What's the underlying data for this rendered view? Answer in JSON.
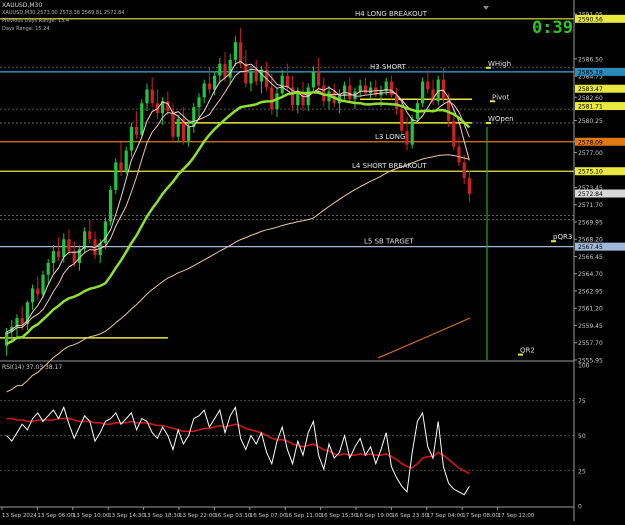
{
  "header": {
    "symbol": "XAUUSD,M30",
    "line1": "XAUUSD,M30  2573.00 2573.38 2569.81 2572.84",
    "line2": "Previous Days Range: 13.4",
    "line3": "Days Range: 15.24",
    "timer": "0:39"
  },
  "colors": {
    "bull": "#20c840",
    "bear": "#d02020",
    "level_yellow": "#e8e840",
    "level_orange": "#e07818",
    "level_blue": "#a0b8d8",
    "level_green": "#28a828",
    "ma_fast": "#e8d8c8",
    "ma_green": "#90e030",
    "ma_slow": "#e8c8a0",
    "ma_orange": "#d87020",
    "rsi": "#ffffff",
    "rsi_signal": "#d01818",
    "axis_text": "#c8c8c8"
  },
  "price_axis": {
    "ticks": [
      "2591.05",
      "2586.50",
      "2584.75",
      "2582.60",
      "2580.25",
      "2578.10",
      "2577.00",
      "2575.25",
      "2573.45",
      "2571.70",
      "2569.95",
      "2568.20",
      "2566.45",
      "2564.70",
      "2562.95",
      "2561.20",
      "2559.45",
      "2557.70",
      "2555.95"
    ],
    "max": 2591.05,
    "min": 2555.95
  },
  "price_tags": [
    {
      "value": 2590.56,
      "label": "2590.56",
      "color": "#e8e840"
    },
    {
      "value": 2585.18,
      "label": "2585.18",
      "color": "#2e8ab8"
    },
    {
      "value": 2583.47,
      "label": "2583.47",
      "color": "#e8e840"
    },
    {
      "value": 2581.71,
      "label": "2581.71",
      "color": "#e8e840"
    },
    {
      "value": 2578.09,
      "label": "2578.09",
      "color": "#e07818"
    },
    {
      "value": 2575.1,
      "label": "2575.10",
      "color": "#e8e840"
    },
    {
      "value": 2572.84,
      "label": "2572.84",
      "color": "#d8d8d8"
    },
    {
      "value": 2567.45,
      "label": "2567.45",
      "color": "#a0b8d8"
    }
  ],
  "levels": [
    {
      "name": "H4 LONG BREAKOUT",
      "value": 2590.56,
      "color": "#e8e840",
      "label_x": 355
    },
    {
      "name": "H3 SHORT",
      "value": 2585.18,
      "color": "#40a8d8",
      "label_x": 370
    },
    {
      "name": "L3 LONG",
      "value": 2578.09,
      "color": "#e07818",
      "label_x": 375
    },
    {
      "name": "L4 SHORT BREAKOUT",
      "value": 2575.1,
      "color": "#e8e840",
      "label_x": 352
    },
    {
      "name": "L5 SB TARGET",
      "value": 2567.45,
      "color": "#a0b8d8",
      "label_x": 364
    }
  ],
  "markers": [
    {
      "name": "WHigh",
      "x": 488,
      "value": 2585.8
    },
    {
      "name": "Pivot",
      "x": 492,
      "value": 2582.4
    },
    {
      "name": "WOpen",
      "x": 488,
      "value": 2580.2
    },
    {
      "name": "pQR3",
      "x": 553,
      "value": 2568.2
    },
    {
      "name": "QR2",
      "x": 520,
      "value": 2556.7
    }
  ],
  "time_axis": [
    "13 Sep 2024",
    "13 Sep 06:00",
    "13 Sep 10:00",
    "13 Sep 14:30",
    "13 Sep 18:30",
    "13 Sep 22:00",
    "16 Sep 03:30",
    "16 Sep 07:00",
    "16 Sep 11:00",
    "16 Sep 15:30",
    "16 Sep 19:00",
    "16 Sep 23:30",
    "17 Sep 04:00",
    "17 Sep 08:00",
    "17 Sep 12:00"
  ],
  "indicator": {
    "title": "RSI(14) 37.03 38.17",
    "ticks": [
      "100",
      "75",
      "50",
      "25",
      "0"
    ]
  },
  "chart_data": {
    "type": "line",
    "title": "XAUUSD,M30",
    "candles": [
      [
        2557.4,
        2559.2,
        2556.4,
        2558.8
      ],
      [
        2558.8,
        2560.0,
        2557.9,
        2559.3
      ],
      [
        2559.3,
        2560.6,
        2558.2,
        2560.2
      ],
      [
        2560.2,
        2561.4,
        2559.0,
        2559.6
      ],
      [
        2559.6,
        2562.0,
        2559.0,
        2561.8
      ],
      [
        2561.8,
        2563.6,
        2561.0,
        2563.2
      ],
      [
        2563.2,
        2564.4,
        2562.0,
        2562.6
      ],
      [
        2562.6,
        2565.0,
        2562.2,
        2564.6
      ],
      [
        2564.6,
        2566.2,
        2563.6,
        2565.8
      ],
      [
        2565.8,
        2567.6,
        2564.8,
        2567.0
      ],
      [
        2567.0,
        2568.4,
        2566.0,
        2566.4
      ],
      [
        2566.4,
        2568.8,
        2565.8,
        2568.2
      ],
      [
        2568.2,
        2569.2,
        2566.6,
        2567.0
      ],
      [
        2567.0,
        2568.0,
        2565.4,
        2565.8
      ],
      [
        2565.8,
        2567.6,
        2565.0,
        2567.2
      ],
      [
        2567.2,
        2569.4,
        2566.8,
        2569.0
      ],
      [
        2569.0,
        2570.2,
        2567.8,
        2568.2
      ],
      [
        2568.2,
        2569.0,
        2566.2,
        2566.6
      ],
      [
        2566.6,
        2568.2,
        2565.8,
        2567.8
      ],
      [
        2567.8,
        2570.4,
        2567.2,
        2570.0
      ],
      [
        2570.0,
        2573.6,
        2569.6,
        2573.2
      ],
      [
        2573.2,
        2576.4,
        2572.8,
        2576.0
      ],
      [
        2576.0,
        2578.0,
        2574.6,
        2575.2
      ],
      [
        2575.2,
        2577.6,
        2574.8,
        2577.2
      ],
      [
        2577.2,
        2580.0,
        2576.6,
        2579.6
      ],
      [
        2579.6,
        2581.2,
        2578.4,
        2578.8
      ],
      [
        2578.8,
        2582.4,
        2578.4,
        2582.0
      ],
      [
        2582.0,
        2584.0,
        2581.2,
        2583.4
      ],
      [
        2583.4,
        2584.6,
        2581.6,
        2582.0
      ],
      [
        2582.0,
        2583.4,
        2580.4,
        2581.0
      ],
      [
        2581.0,
        2582.6,
        2579.8,
        2582.2
      ],
      [
        2582.2,
        2583.2,
        2580.8,
        2581.2
      ],
      [
        2581.2,
        2582.0,
        2578.2,
        2578.6
      ],
      [
        2578.6,
        2580.8,
        2578.0,
        2580.4
      ],
      [
        2580.4,
        2581.6,
        2577.8,
        2578.2
      ],
      [
        2578.2,
        2580.2,
        2577.6,
        2579.6
      ],
      [
        2579.6,
        2582.0,
        2579.0,
        2581.6
      ],
      [
        2581.6,
        2583.0,
        2580.6,
        2582.6
      ],
      [
        2582.6,
        2584.4,
        2582.0,
        2584.0
      ],
      [
        2584.0,
        2585.6,
        2583.0,
        2583.4
      ],
      [
        2583.4,
        2585.2,
        2582.8,
        2584.8
      ],
      [
        2584.8,
        2586.6,
        2584.0,
        2586.0
      ],
      [
        2586.0,
        2587.2,
        2584.2,
        2584.6
      ],
      [
        2584.6,
        2587.0,
        2584.0,
        2586.4
      ],
      [
        2586.4,
        2588.8,
        2585.8,
        2588.2
      ],
      [
        2588.2,
        2589.6,
        2585.6,
        2586.0
      ],
      [
        2586.0,
        2587.4,
        2583.6,
        2584.0
      ],
      [
        2584.0,
        2585.8,
        2583.2,
        2585.2
      ],
      [
        2585.2,
        2586.4,
        2583.8,
        2584.2
      ],
      [
        2584.2,
        2585.8,
        2583.0,
        2585.4
      ],
      [
        2585.4,
        2586.2,
        2583.2,
        2583.6
      ],
      [
        2583.6,
        2585.0,
        2580.8,
        2581.4
      ],
      [
        2581.4,
        2583.6,
        2580.6,
        2583.0
      ],
      [
        2583.0,
        2585.4,
        2582.6,
        2584.8
      ],
      [
        2584.8,
        2586.0,
        2583.2,
        2583.6
      ],
      [
        2583.6,
        2584.8,
        2581.2,
        2581.8
      ],
      [
        2581.8,
        2583.6,
        2581.0,
        2583.0
      ],
      [
        2583.0,
        2584.2,
        2581.2,
        2581.8
      ],
      [
        2581.8,
        2584.0,
        2581.2,
        2583.6
      ],
      [
        2583.6,
        2585.8,
        2583.0,
        2585.2
      ],
      [
        2585.2,
        2586.6,
        2583.4,
        2583.8
      ],
      [
        2583.8,
        2584.6,
        2581.6,
        2582.2
      ],
      [
        2582.2,
        2583.8,
        2581.4,
        2583.2
      ],
      [
        2583.2,
        2584.0,
        2581.6,
        2582.0
      ],
      [
        2582.0,
        2583.4,
        2581.0,
        2582.8
      ],
      [
        2582.8,
        2584.2,
        2582.2,
        2583.8
      ],
      [
        2583.8,
        2584.6,
        2582.0,
        2582.4
      ],
      [
        2582.4,
        2583.6,
        2581.4,
        2583.2
      ],
      [
        2583.2,
        2584.4,
        2582.6,
        2583.8
      ],
      [
        2583.8,
        2584.6,
        2582.8,
        2583.0
      ],
      [
        2583.0,
        2584.2,
        2582.4,
        2583.6
      ],
      [
        2583.6,
        2584.4,
        2582.6,
        2582.8
      ],
      [
        2582.8,
        2583.8,
        2581.6,
        2583.2
      ],
      [
        2583.2,
        2584.6,
        2582.8,
        2584.2
      ],
      [
        2584.2,
        2584.8,
        2582.4,
        2582.8
      ],
      [
        2582.8,
        2583.6,
        2580.8,
        2581.4
      ],
      [
        2581.4,
        2582.2,
        2578.8,
        2579.2
      ],
      [
        2579.2,
        2580.6,
        2577.2,
        2577.8
      ],
      [
        2577.8,
        2580.8,
        2577.4,
        2580.4
      ],
      [
        2580.4,
        2582.4,
        2580.0,
        2582.0
      ],
      [
        2582.0,
        2584.6,
        2581.6,
        2584.2
      ],
      [
        2584.2,
        2585.4,
        2583.0,
        2583.4
      ],
      [
        2583.4,
        2584.4,
        2581.8,
        2582.2
      ],
      [
        2582.2,
        2584.8,
        2581.8,
        2584.4
      ],
      [
        2584.4,
        2585.6,
        2582.0,
        2582.4
      ],
      [
        2582.4,
        2583.0,
        2579.6,
        2580.2
      ],
      [
        2580.2,
        2581.4,
        2577.2,
        2577.6
      ],
      [
        2577.6,
        2578.6,
        2575.6,
        2576.0
      ],
      [
        2576.0,
        2576.8,
        2573.8,
        2574.4
      ],
      [
        2574.4,
        2575.2,
        2572.0,
        2572.8
      ]
    ],
    "series": [
      {
        "name": "",
        "values": []
      }
    ],
    "rsi": [
      50,
      46,
      52,
      58,
      54,
      62,
      66,
      60,
      64,
      68,
      62,
      70,
      58,
      48,
      56,
      64,
      60,
      46,
      52,
      60,
      62,
      66,
      58,
      62,
      66,
      54,
      62,
      60,
      52,
      48,
      56,
      50,
      40,
      54,
      44,
      50,
      62,
      64,
      68,
      56,
      62,
      68,
      52,
      64,
      70,
      48,
      40,
      50,
      44,
      52,
      38,
      30,
      46,
      56,
      40,
      30,
      46,
      36,
      52,
      60,
      36,
      26,
      44,
      34,
      38,
      50,
      34,
      42,
      48,
      36,
      42,
      30,
      40,
      52,
      28,
      20,
      14,
      10,
      38,
      60,
      66,
      42,
      34,
      60,
      28,
      16,
      12,
      10,
      8,
      14
    ],
    "rsi_signal": [
      62,
      62,
      61,
      61,
      60,
      60,
      61,
      61,
      61,
      61,
      62,
      62,
      62,
      61,
      60,
      60,
      60,
      59,
      59,
      58,
      58,
      59,
      59,
      59,
      60,
      59,
      59,
      59,
      58,
      57,
      57,
      56,
      55,
      54,
      53,
      53,
      53,
      54,
      55,
      55,
      56,
      57,
      56,
      57,
      58,
      57,
      55,
      54,
      53,
      52,
      50,
      48,
      47,
      47,
      46,
      44,
      43,
      42,
      43,
      44,
      42,
      40,
      39,
      37,
      36,
      37,
      36,
      36,
      37,
      36,
      37,
      36,
      36,
      37,
      35,
      33,
      30,
      28,
      27,
      30,
      34,
      35,
      35,
      38,
      36,
      33,
      30,
      27,
      25,
      23
    ],
    "xlabel": "",
    "ylabel": "",
    "ylim": [
      2555.95,
      2591.05
    ]
  }
}
